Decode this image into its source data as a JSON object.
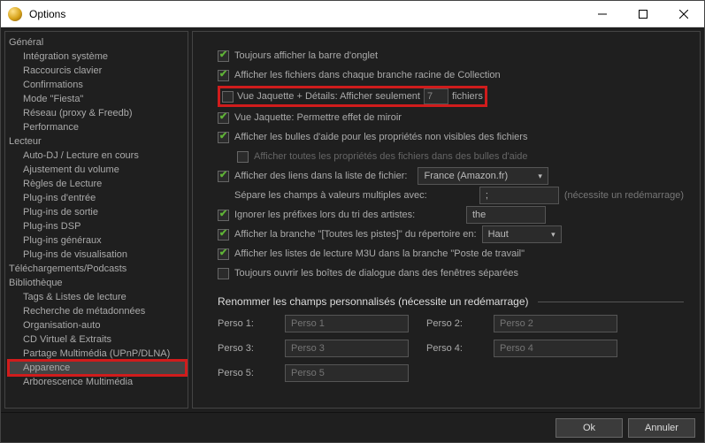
{
  "window": {
    "title": "Options"
  },
  "sidebar": {
    "groups": [
      {
        "label": "Général",
        "items": [
          "Intégration système",
          "Raccourcis clavier",
          "Confirmations",
          "Mode \"Fiesta\"",
          "Réseau (proxy & Freedb)",
          "Performance"
        ]
      },
      {
        "label": "Lecteur",
        "items": [
          "Auto-DJ / Lecture en cours",
          "Ajustement du volume",
          "Règles de Lecture",
          "Plug-ins d'entrée",
          "Plug-ins de sortie",
          "Plug-ins DSP",
          "Plug-ins généraux",
          "Plug-ins de visualisation"
        ]
      },
      {
        "label": "Téléchargements/Podcasts",
        "items": []
      },
      {
        "label": "Bibliothèque",
        "items": [
          "Tags & Listes de lecture",
          "Recherche de métadonnées",
          "Organisation-auto",
          "CD Virtuel & Extraits",
          "Partage Multimédia (UPnP/DLNA)",
          "Apparence",
          "Arborescence Multimédia"
        ]
      }
    ],
    "selected": "Apparence"
  },
  "options": {
    "always_show_tabs": "Toujours afficher la barre d'onglet",
    "show_files_each_branch": "Afficher les fichiers dans chaque branche racine de Collection",
    "jacket_details_prefix": "Vue Jaquette + Détails: Afficher seulement",
    "jacket_details_value": "7",
    "jacket_details_suffix": "fichiers",
    "jacket_mirror": "Vue Jaquette: Permettre effet de miroir",
    "tooltips_hidden_props": "Afficher les bulles d'aide pour les propriétés non visibles des fichiers",
    "tooltips_all_props": "Afficher toutes les propriétés des fichiers dans des bulles d'aide",
    "links_in_filelist": "Afficher des liens dans la liste de fichier:",
    "links_select": "France (Amazon.fr)",
    "multival_sep_label": "Sépare les champs à valeurs multiples avec:",
    "multival_sep_value": ";",
    "multival_sep_note": "(nécessite un redémarrage)",
    "ignore_prefixes_label": "Ignorer les préfixes lors du tri des artistes:",
    "ignore_prefixes_value": "the",
    "show_alltracks_branch": "Afficher la branche \"[Toutes les pistes]\" du répertoire en:",
    "alltracks_select": "Haut",
    "show_m3u_workstation": "Afficher les listes de lecture M3U dans la branche \"Poste de travail\"",
    "always_open_separate": "Toujours ouvrir les boîtes de dialogue dans des fenêtres séparées",
    "rename_section": "Renommer les champs personnalisés (nécessite un redémarrage)",
    "perso": {
      "l1": "Perso 1:",
      "p1": "Perso 1",
      "l2": "Perso 2:",
      "p2": "Perso 2",
      "l3": "Perso 3:",
      "p3": "Perso 3",
      "l4": "Perso 4:",
      "p4": "Perso 4",
      "l5": "Perso 5:",
      "p5": "Perso 5"
    }
  },
  "footer": {
    "ok": "Ok",
    "cancel": "Annuler"
  }
}
